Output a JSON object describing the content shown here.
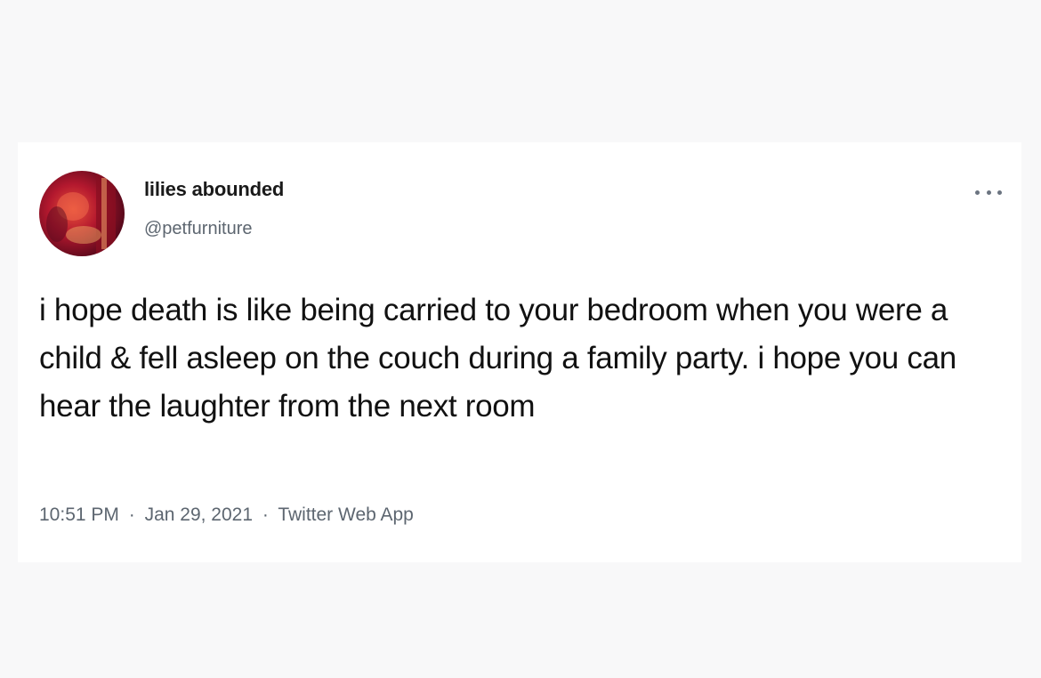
{
  "tweet": {
    "author": {
      "display_name": "lilies abounded",
      "handle": "@petfurniture",
      "avatar_icon": "profile-photo-avatar"
    },
    "more_icon": "ellipsis-icon",
    "text": "i hope death is like being carried to your bedroom when you were a child & fell asleep on the couch during a family party. i hope you can hear the laughter from the next room",
    "meta": {
      "time": "10:51 PM",
      "separator": "·",
      "date": "Jan 29, 2021",
      "source": "Twitter Web App"
    }
  },
  "colors": {
    "background": "#f8f8f9",
    "card": "#ffffff",
    "text_primary": "#111111",
    "text_secondary": "#5d6670"
  }
}
